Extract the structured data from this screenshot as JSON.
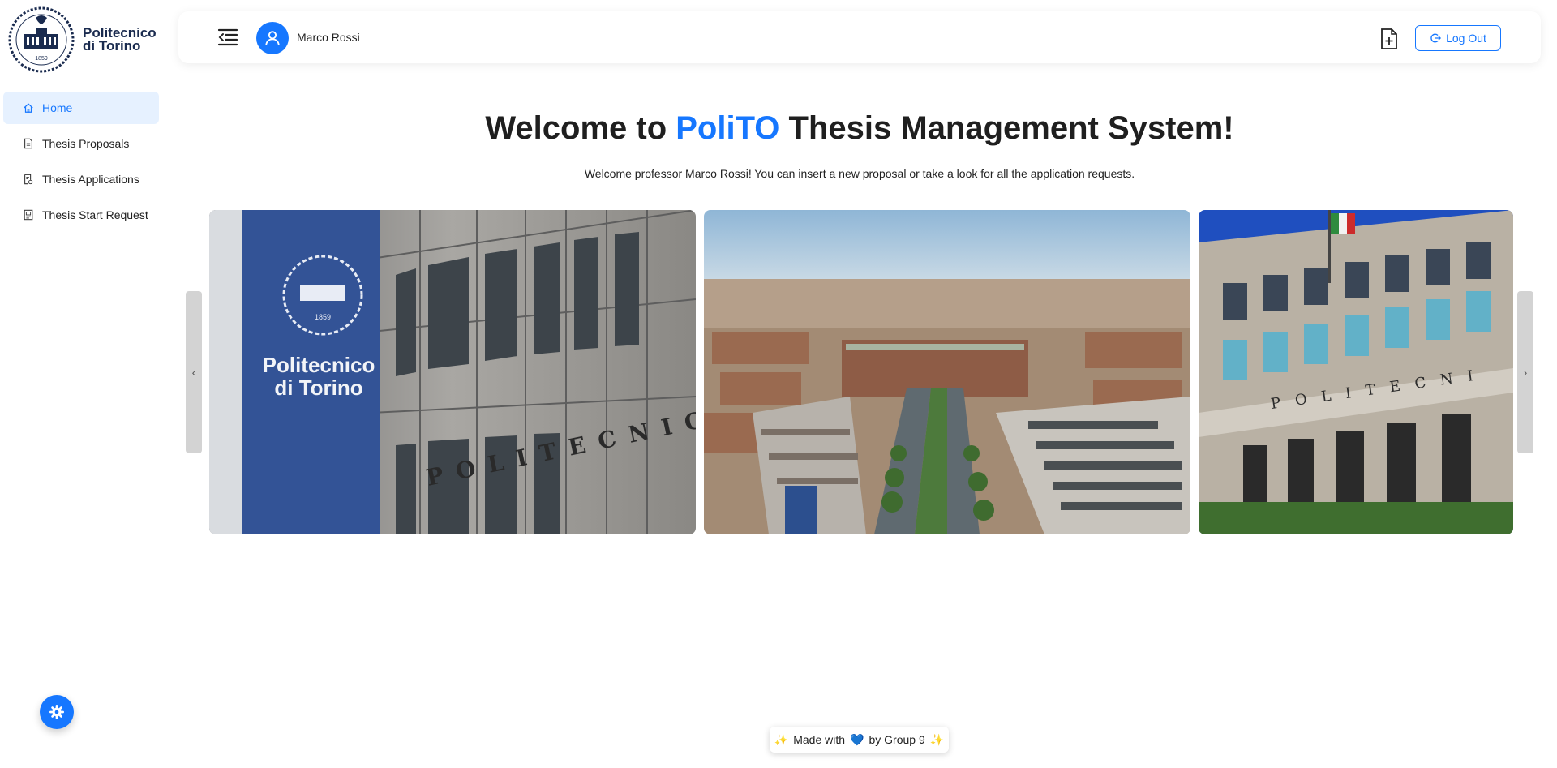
{
  "logo": {
    "line1": "Politecnico",
    "line2": "di Torino",
    "seal_year": "1859"
  },
  "sidebar": {
    "items": [
      {
        "label": "Home",
        "icon": "home-icon",
        "active": true
      },
      {
        "label": "Thesis Proposals",
        "icon": "document-icon",
        "active": false
      },
      {
        "label": "Thesis Applications",
        "icon": "application-icon",
        "active": false
      },
      {
        "label": "Thesis Start Request",
        "icon": "request-icon",
        "active": false
      }
    ]
  },
  "header": {
    "user_name": "Marco Rossi",
    "logout_label": "Log Out"
  },
  "main": {
    "title_prefix": "Welcome to ",
    "title_accent": "PoliTO",
    "title_suffix": " Thesis Management System!",
    "subtitle": "Welcome professor Marco Rossi! You can insert a new proposal or take a look for all the application requests."
  },
  "carousel": {
    "slides": [
      {
        "scene": "campus-facade-with-banner",
        "banner_line1": "Politecnico",
        "banner_line2": "di Torino",
        "banner_year": "1859",
        "facade_text": "POLITECNICO"
      },
      {
        "scene": "aerial-view-turin"
      },
      {
        "scene": "main-entrance-building",
        "facade_text": "POLITECNI"
      }
    ],
    "prev_glyph": "‹",
    "next_glyph": "›"
  },
  "footer": {
    "prefix": "Made with",
    "suffix": "by Group 9",
    "spark": "✨",
    "heart": "💙"
  },
  "colors": {
    "accent": "#1677ff",
    "active_bg": "#e6f1ff",
    "text": "#1f1f1f"
  }
}
